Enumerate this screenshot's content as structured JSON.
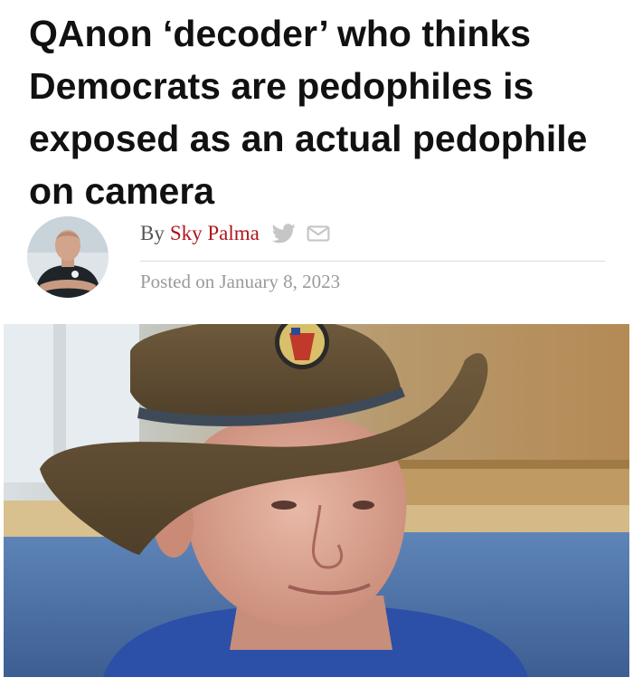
{
  "article": {
    "headline": "QAnon ‘decoder’ who thinks Democrats are pedophiles is exposed as an actual pedophile on camera",
    "byline_prefix": "By",
    "author": "Sky Palma",
    "posted_text": "Posted on January 8, 2023"
  },
  "share_icons": [
    "twitter-icon",
    "email-icon"
  ],
  "colors": {
    "author_link": "#b0141c",
    "headline": "#111111",
    "meta_text": "#9a9a9a"
  }
}
